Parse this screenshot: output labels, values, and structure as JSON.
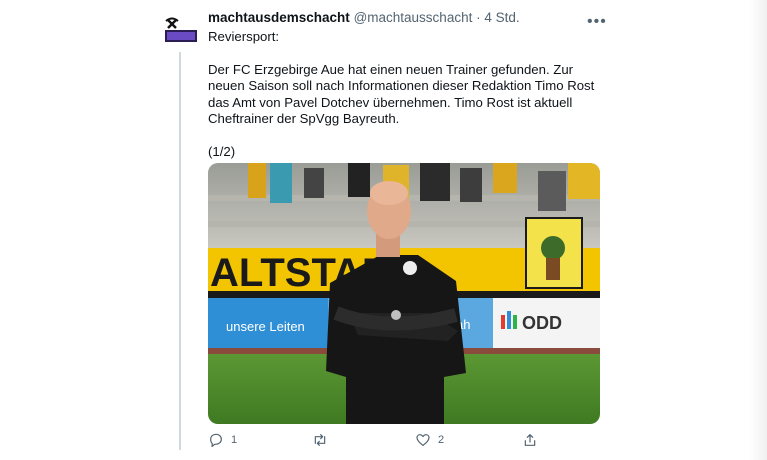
{
  "tweet": {
    "display_name": "machtausdemschacht",
    "handle": "@machtausschacht",
    "separator": "·",
    "time": "4 Std.",
    "more_label": "•••",
    "source_line": "Reviersport:",
    "paragraph": "Der FC Erzgebirge Aue hat einen neuen Trainer gefunden. Zur neuen Saison soll nach Informationen dieser Redaktion Timo Rost das Amt von Pavel Dotchev übernehmen. Timo Rost ist aktuell Cheftrainer der SpVgg Bayreuth.",
    "counter": "(1/2)"
  },
  "photo": {
    "banner_text": "ALTSTADT",
    "sponsor_left": "unsere Leiten",
    "sponsor_right": "ODD",
    "sponsor_mid": "ah"
  },
  "actions": {
    "reply_count": "1",
    "retweet_count": "",
    "like_count": "2"
  },
  "colors": {
    "text": "#0f1419",
    "muted": "#536471",
    "thread_line": "#cfd9de",
    "banner_yellow": "#f2c500",
    "pitch_green": "#4f8f2e"
  }
}
